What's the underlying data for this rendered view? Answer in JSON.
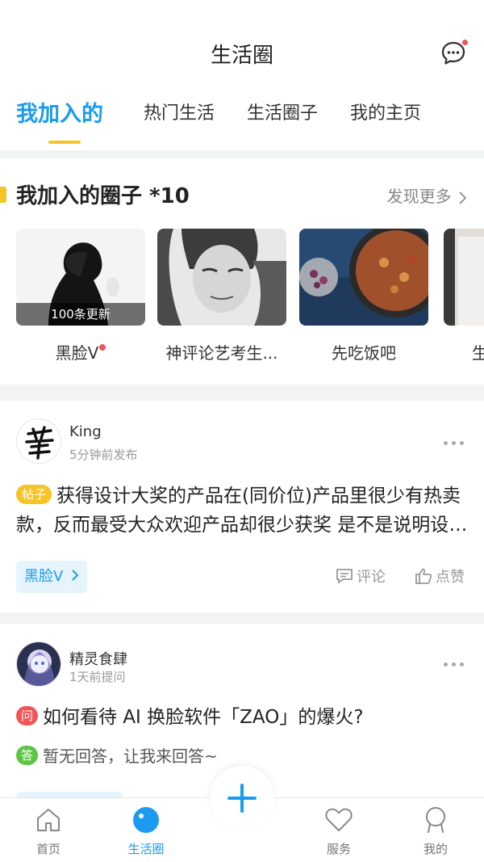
{
  "header": {
    "title": "生活圈"
  },
  "tabs": [
    {
      "label": "我加入的",
      "active": true
    },
    {
      "label": "热门生活",
      "active": false
    },
    {
      "label": "生活圈子",
      "active": false
    },
    {
      "label": "我的主页",
      "active": false
    }
  ],
  "groups": {
    "title": "我加入的圈子 *10",
    "discover_label": "发现更多",
    "items": [
      {
        "name": "黑脸V",
        "badge": "100条更新",
        "has_new_dot": true
      },
      {
        "name": "神评论艺考生...",
        "badge": "",
        "has_new_dot": false
      },
      {
        "name": "先吃饭吧",
        "badge": "",
        "has_new_dot": false
      },
      {
        "name": "生",
        "badge": "",
        "has_new_dot": false
      }
    ]
  },
  "posts": [
    {
      "author": "King",
      "time": "5分钟前发布",
      "type_badge": "帖子",
      "text": "获得设计大奖的产品在(同价位)产品里很少有热卖款，反而最受大众欢迎产品却很少获奖 是不是说明设计大奖有问题",
      "circle_tag": "黑脸V",
      "comment_label": "评论",
      "like_label": "点赞"
    },
    {
      "author": "精灵食肆",
      "time": "1天前提问",
      "type_badge": "问",
      "text": "如何看待 AI 换脸软件「ZAO」的爆火?",
      "answer_badge": "答",
      "answer_text": "暂无回答，让我来回答~"
    }
  ],
  "tabbar": {
    "items": [
      {
        "label": "首页",
        "active": false
      },
      {
        "label": "生活圈",
        "active": true
      },
      {
        "label": "服务",
        "active": false
      },
      {
        "label": "我的",
        "active": false
      }
    ]
  },
  "colors": {
    "accent": "#1a9bf0",
    "highlight": "#f7c325",
    "notice_red": "#f05656",
    "answer_green": "#5ec544"
  }
}
